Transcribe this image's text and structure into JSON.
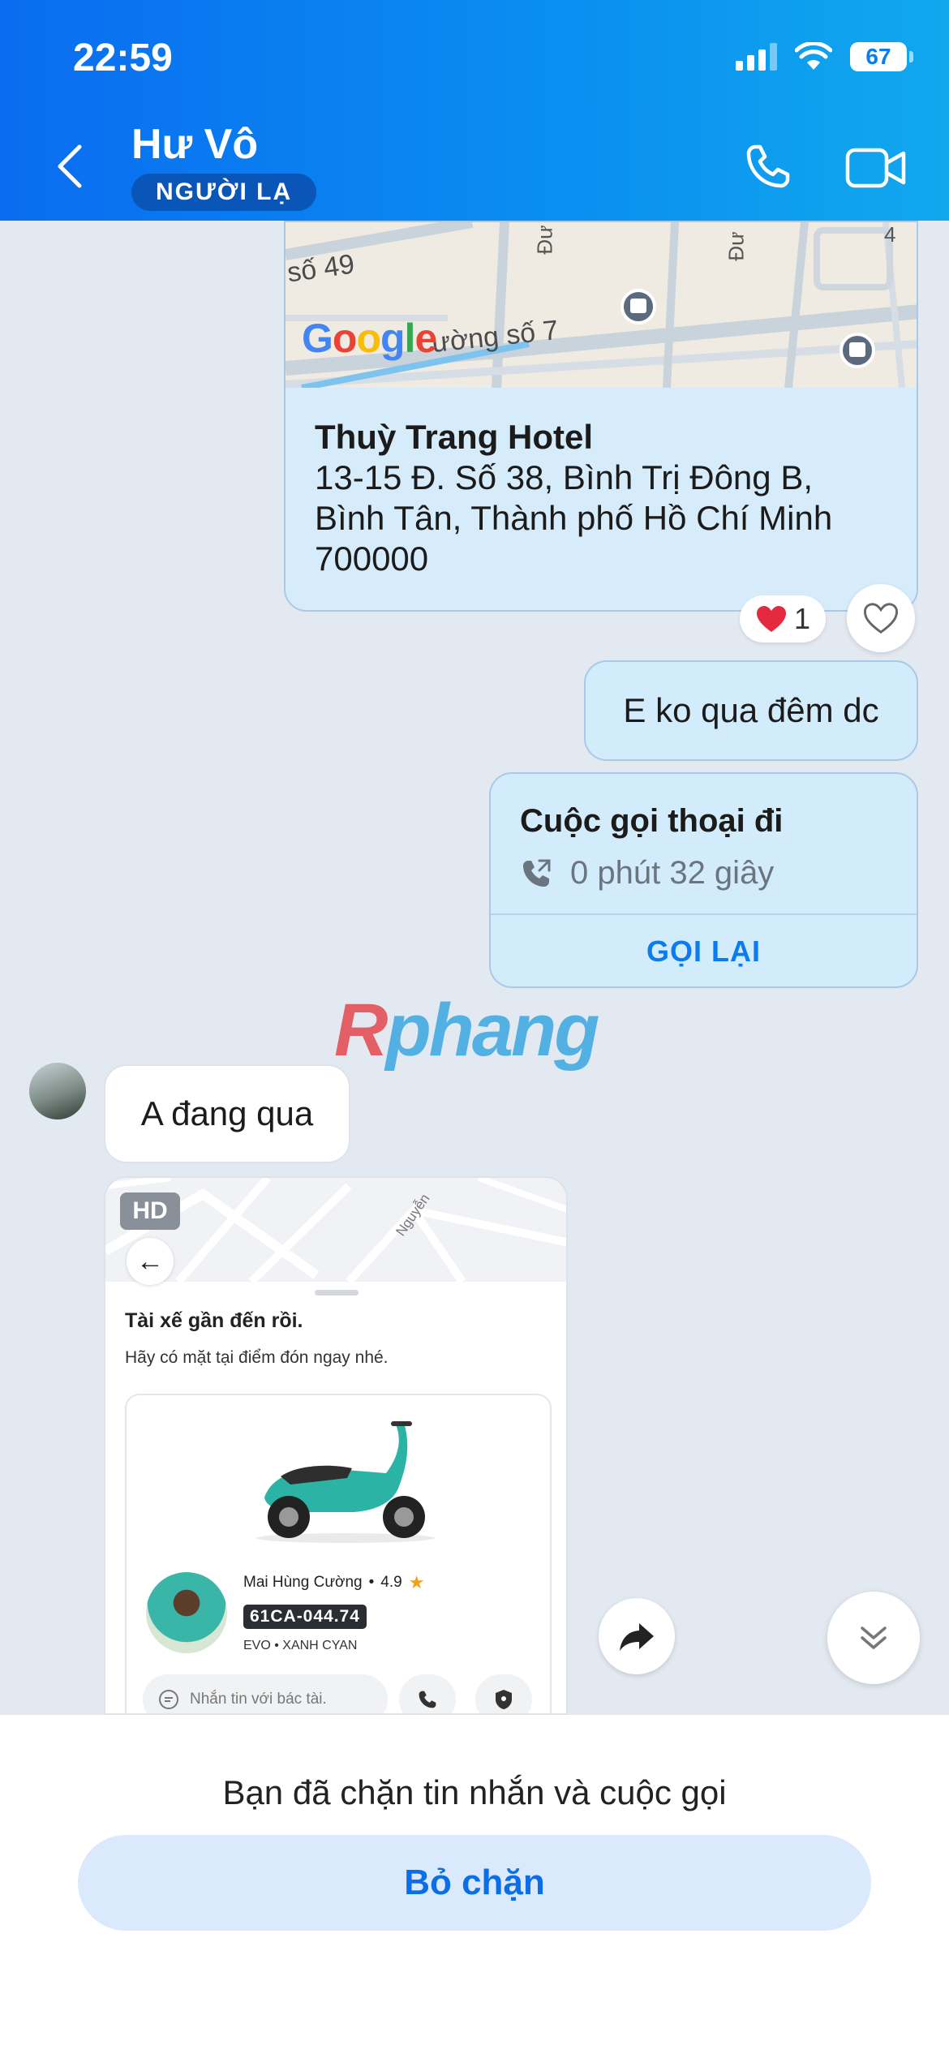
{
  "status_bar": {
    "time": "22:59",
    "battery": "67"
  },
  "header": {
    "title": "Hư Vô",
    "badge": "NGƯỜI LẠ"
  },
  "location_message": {
    "map_logo": "Google",
    "map_labels": [
      "số 49",
      "ường số 7",
      "Đư",
      "Đư",
      "4"
    ],
    "place_name": "Thuỳ Trang Hotel",
    "address_line1": "13-15 Đ. Số 38, Bình Trị Đông B,",
    "address_line2": "Bình Tân, Thành phố Hồ Chí Minh",
    "address_line3": "700000",
    "reaction_count": "1"
  },
  "messages": {
    "out_text": "E ko qua đêm dc",
    "call_title": "Cuộc gọi thoại đi",
    "call_duration": "0 phút 32 giây",
    "call_again": "GỌI LẠI",
    "in_text": "A đang qua"
  },
  "watermark": {
    "part1": "R",
    "part2": "phang"
  },
  "image_message": {
    "hd": "HD",
    "heading": "Tài xế gần đến rồi.",
    "subheading": "Hãy có mặt tại điểm đón ngay nhé.",
    "driver_name": "Mai Hùng Cường",
    "rating": "4.9",
    "plate": "61CA-044.74",
    "vehicle": "EVO • XANH CYAN",
    "message_placeholder": "Nhắn tin với bác tài.",
    "map_street": "Nguyễn"
  },
  "footer": {
    "blocked_notice": "Bạn đã chặn tin nhắn và cuộc gọi",
    "unblock_label": "Bỏ chặn"
  },
  "colors": {
    "header_start": "#0a6cf0",
    "header_end": "#11a8ee",
    "outgoing_bubble": "#d3ecfc",
    "accent": "#0a7bf0",
    "chat_background": "#e3e9f1"
  }
}
